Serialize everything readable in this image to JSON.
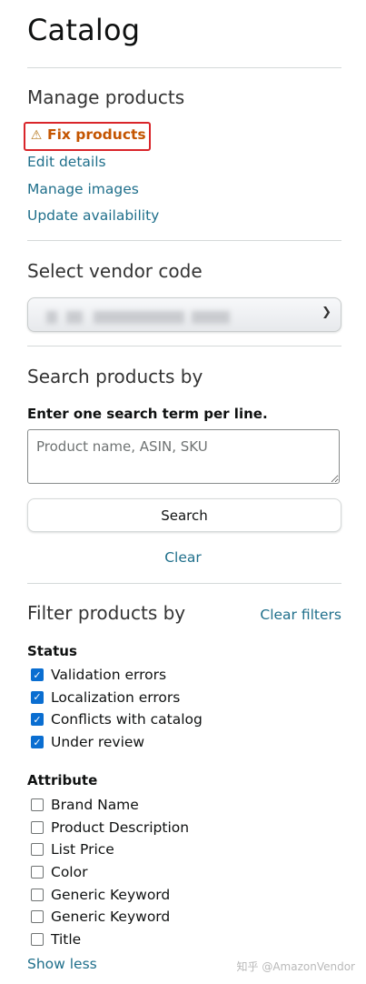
{
  "page": {
    "title": "Catalog"
  },
  "manage": {
    "heading": "Manage products",
    "fix_label": "Fix products",
    "links": [
      "Edit details",
      "Manage images",
      "Update availability"
    ]
  },
  "vendor": {
    "heading": "Select vendor code"
  },
  "search": {
    "heading": "Search products by",
    "instruction": "Enter one search term per line.",
    "placeholder": "Product name, ASIN, SKU",
    "button": "Search",
    "clear": "Clear"
  },
  "filter": {
    "heading": "Filter products by",
    "clear_filters": "Clear filters",
    "status_label": "Status",
    "status_items": [
      {
        "label": "Validation errors",
        "checked": true
      },
      {
        "label": "Localization errors",
        "checked": true
      },
      {
        "label": "Conflicts with catalog",
        "checked": true
      },
      {
        "label": "Under review",
        "checked": true
      }
    ],
    "attribute_label": "Attribute",
    "attribute_items": [
      {
        "label": "Brand Name",
        "checked": false
      },
      {
        "label": "Product Description",
        "checked": false
      },
      {
        "label": "List Price",
        "checked": false
      },
      {
        "label": "Color",
        "checked": false
      },
      {
        "label": "Generic Keyword",
        "checked": false
      },
      {
        "label": "Generic Keyword",
        "checked": false
      },
      {
        "label": "Title",
        "checked": false
      }
    ],
    "show_less": "Show less"
  },
  "watermark": "知乎 @AmazonVendor"
}
